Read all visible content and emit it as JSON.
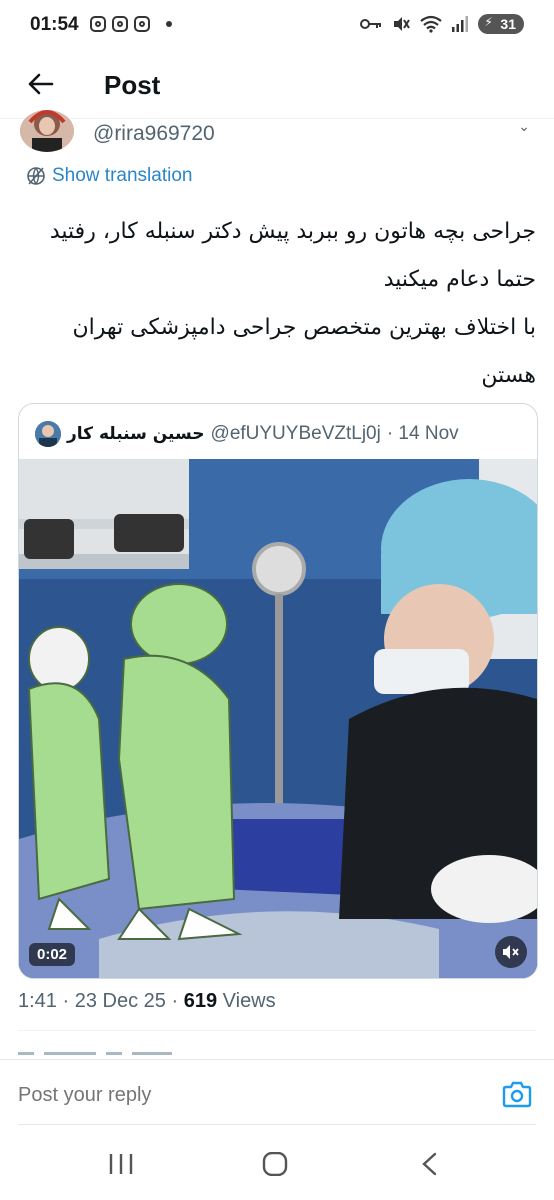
{
  "status_bar": {
    "time": "01:54",
    "battery": "31",
    "icons": [
      "instagram-icon",
      "instagram-icon",
      "instagram-icon",
      "key-icon",
      "mute-icon",
      "wifi-icon",
      "signal-icon"
    ]
  },
  "header": {
    "title": "Post",
    "back_icon": "back-arrow-icon"
  },
  "author": {
    "handle": "@rira969720"
  },
  "translation": {
    "label": "Show translation",
    "icon": "globe-icon"
  },
  "tweet": {
    "lines": [
      "جراحی بچه هاتون رو ببربد پیش دکتر سنبله کار، رفتید حتما دعام میکنید",
      "با اختلاف بهترین متخصص جراحی دامپزشکی تهران هستن"
    ]
  },
  "quote": {
    "name": "حسین سنبله کار",
    "handle": "@efUYUYBeVZtLj0j",
    "date": "· 14 Nov",
    "video_time": "0:02",
    "mute_icon": "volume-muted-icon"
  },
  "meta": {
    "time": "1:41",
    "date": "23 Dec 25",
    "sep": "·",
    "views_count": "619",
    "views_label": "Views"
  },
  "reply": {
    "placeholder": "Post your reply",
    "camera_icon": "camera-icon"
  },
  "nav": {
    "icons": [
      "recents-icon",
      "home-icon",
      "back-icon"
    ]
  },
  "colors": {
    "link": "#2a86c8",
    "secondary_text": "#536471",
    "text": "#0f1419",
    "accent": "#1d9bf0"
  }
}
